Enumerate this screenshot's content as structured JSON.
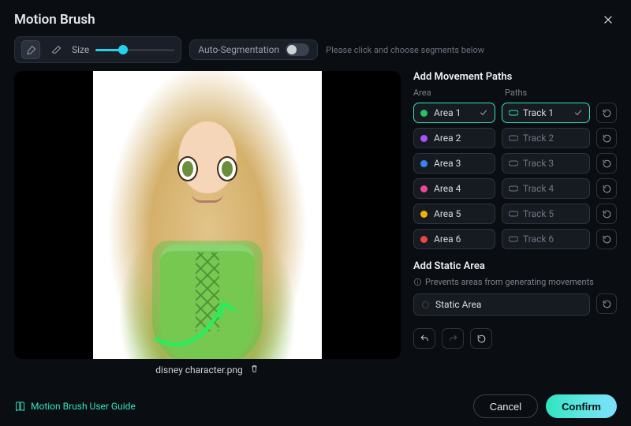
{
  "title": "Motion Brush",
  "toolbar": {
    "size_label": "Size",
    "autoseg_label": "Auto-Segmentation",
    "hint": "Please click and choose segments below"
  },
  "canvas": {
    "filename": "disney character.png"
  },
  "movement": {
    "title": "Add Movement Paths",
    "area_header": "Area",
    "paths_header": "Paths",
    "areas": [
      {
        "label": "Area 1",
        "color": "#22c55e",
        "selected": true
      },
      {
        "label": "Area 2",
        "color": "#a855f7",
        "selected": false
      },
      {
        "label": "Area 3",
        "color": "#3b82f6",
        "selected": false
      },
      {
        "label": "Area 4",
        "color": "#ec4899",
        "selected": false
      },
      {
        "label": "Area 5",
        "color": "#eab308",
        "selected": false
      },
      {
        "label": "Area 6",
        "color": "#ef4444",
        "selected": false
      }
    ],
    "tracks": [
      {
        "label": "Track 1",
        "selected": true,
        "color": "#2fe3c0"
      },
      {
        "label": "Track 2",
        "selected": false
      },
      {
        "label": "Track 3",
        "selected": false
      },
      {
        "label": "Track 4",
        "selected": false
      },
      {
        "label": "Track 5",
        "selected": false
      },
      {
        "label": "Track 6",
        "selected": false
      }
    ]
  },
  "static": {
    "title": "Add Static Area",
    "desc": "Prevents areas from generating movements",
    "label": "Static Area"
  },
  "footer": {
    "guide": "Motion Brush User Guide",
    "cancel": "Cancel",
    "confirm": "Confirm"
  }
}
